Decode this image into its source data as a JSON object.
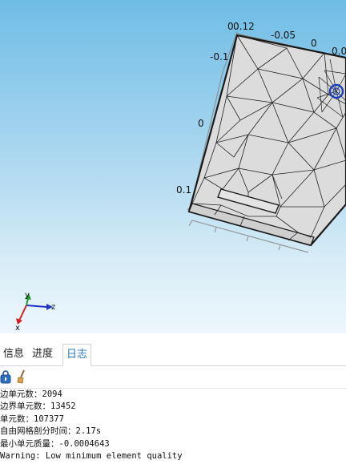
{
  "graphics": {
    "axis_labels": [
      "0",
      "0.12",
      "-0.05",
      "0",
      "0.0",
      "-0.1",
      "0",
      "0.1"
    ],
    "triad": {
      "y": "y",
      "z": "z",
      "x": "x"
    }
  },
  "tabs": [
    {
      "label": "信息"
    },
    {
      "label": "进度"
    },
    {
      "label": "日志"
    }
  ],
  "active_tab": "日志",
  "toolbar": {
    "lock_icon": "lock-icon",
    "clear_icon": "broom-icon"
  },
  "log": {
    "lines": [
      "边单元数：2094",
      "边界单元数：13452",
      "单元数：107377",
      "自由网格剖分时间：2.17s",
      "最小单元质量：-0.0004643",
      "Warning: Low minimum element quality"
    ]
  }
}
